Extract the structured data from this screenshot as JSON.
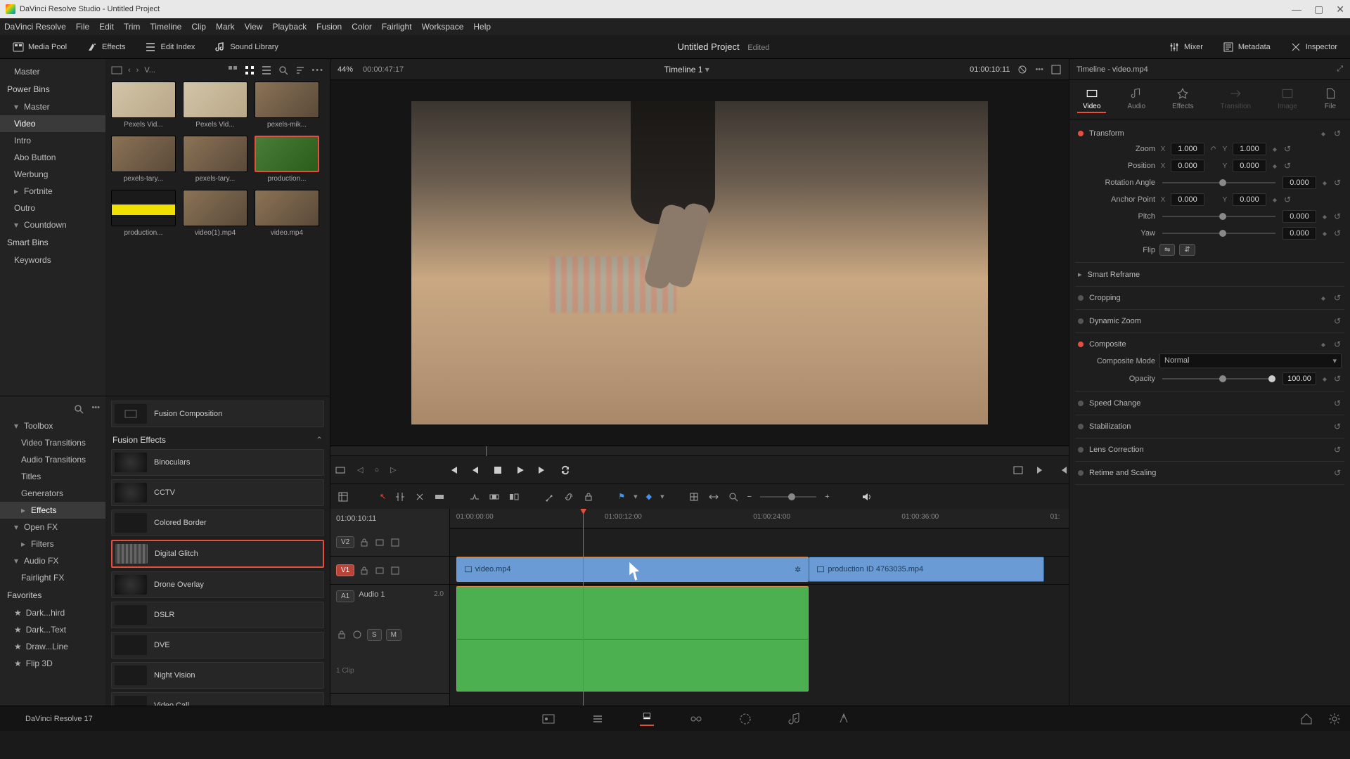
{
  "window": {
    "title": "DaVinci Resolve Studio - Untitled Project"
  },
  "menu": [
    "DaVinci Resolve",
    "File",
    "Edit",
    "Trim",
    "Timeline",
    "Clip",
    "Mark",
    "View",
    "Playback",
    "Fusion",
    "Color",
    "Fairlight",
    "Workspace",
    "Help"
  ],
  "topbar": {
    "mediapool": "Media Pool",
    "effects": "Effects",
    "editindex": "Edit Index",
    "soundlib": "Sound Library",
    "project": "Untitled Project",
    "edited": "Edited",
    "mixer": "Mixer",
    "metadata": "Metadata",
    "inspector": "Inspector"
  },
  "bins": {
    "master": "Master",
    "powerbins_hdr": "Power Bins",
    "pb_master": "Master",
    "items": [
      "Video",
      "Intro",
      "Abo Button",
      "Werbung",
      "Fortnite",
      "Outro",
      "Countdown"
    ],
    "smartbins_hdr": "Smart Bins",
    "keywords": "Keywords"
  },
  "pool_head": {
    "label": "V..."
  },
  "clips": [
    {
      "name": "Pexels Vid..."
    },
    {
      "name": "Pexels Vid..."
    },
    {
      "name": "pexels-mik..."
    },
    {
      "name": "pexels-tary..."
    },
    {
      "name": "pexels-tary..."
    },
    {
      "name": "production..."
    },
    {
      "name": "production..."
    },
    {
      "name": "video(1).mp4"
    },
    {
      "name": "video.mp4"
    }
  ],
  "fx_tree": {
    "toolbox": "Toolbox",
    "video_trans": "Video Transitions",
    "audio_trans": "Audio Transitions",
    "titles": "Titles",
    "generators": "Generators",
    "effects": "Effects",
    "openfx": "Open FX",
    "filters": "Filters",
    "audiofx": "Audio FX",
    "fairlight": "Fairlight FX",
    "favorites_hdr": "Favorites",
    "favs": [
      "Dark...hird",
      "Dark...Text",
      "Draw...Line",
      "Flip 3D"
    ]
  },
  "fx_list": {
    "first": "Fusion Composition",
    "header": "Fusion Effects",
    "items": [
      "Binoculars",
      "CCTV",
      "Colored Border",
      "Digital Glitch",
      "Drone Overlay",
      "DSLR",
      "DVE",
      "Night Vision",
      "Video Call"
    ]
  },
  "viewer": {
    "zoom": "44%",
    "src_tc": "00:00:47:17",
    "title": "Timeline 1",
    "rec_tc": "01:00:10:11"
  },
  "timeline": {
    "tc": "01:00:10:11",
    "ticks": [
      "01:00:00:00",
      "01:00:12:00",
      "01:00:24:00",
      "01:00:36:00",
      "01:"
    ],
    "v2": "V2",
    "v1": "V1",
    "a1": "A1",
    "audio1": "Audio 1",
    "audio_sub": "1 Clip",
    "a_ch": "2.0",
    "s": "S",
    "m": "M",
    "clip1": "video.mp4",
    "clip2": "production ID 4763035.mp4"
  },
  "inspector": {
    "title": "Timeline - video.mp4",
    "tabs": [
      "Video",
      "Audio",
      "Effects",
      "Transition",
      "Image",
      "File"
    ],
    "transform": "Transform",
    "zoom": "Zoom",
    "zoom_x": "1.000",
    "zoom_y": "1.000",
    "position": "Position",
    "pos_x": "0.000",
    "pos_y": "0.000",
    "rotation": "Rotation Angle",
    "rot_v": "0.000",
    "anchor": "Anchor Point",
    "anc_x": "0.000",
    "anc_y": "0.000",
    "pitch": "Pitch",
    "pitch_v": "0.000",
    "yaw": "Yaw",
    "yaw_v": "0.000",
    "flip": "Flip",
    "smart_reframe": "Smart Reframe",
    "cropping": "Cropping",
    "dynzoom": "Dynamic Zoom",
    "composite": "Composite",
    "comp_mode_l": "Composite Mode",
    "comp_mode_v": "Normal",
    "opacity_l": "Opacity",
    "opacity_v": "100.00",
    "speed": "Speed Change",
    "stab": "Stabilization",
    "lens": "Lens Correction",
    "retime": "Retime and Scaling"
  },
  "pagebar": {
    "app": "DaVinci Resolve 17"
  }
}
